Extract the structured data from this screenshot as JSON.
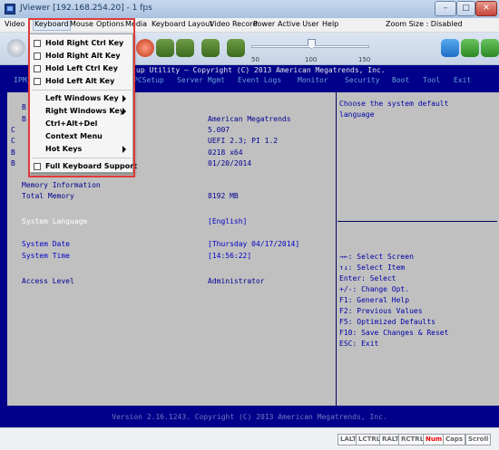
{
  "window": {
    "title": "JViewer [192.168.254.20] - 1 fps",
    "minimize": "–",
    "maximize": "□",
    "close": "✕"
  },
  "menubar": {
    "items": [
      "Video",
      "Keyboard",
      "Mouse",
      "Options",
      "Media",
      "Keyboard Layout",
      "Video Record",
      "Power",
      "Active User",
      "Help"
    ],
    "zoom": "Zoom Size : Disabled"
  },
  "toolbar": {
    "slider": {
      "min_label": "50",
      "mid_label": "100",
      "max_label": "150"
    }
  },
  "keyboard_menu": {
    "items": [
      {
        "label": "Hold Right Ctrl Key",
        "checkbox": true,
        "submenu": false
      },
      {
        "label": "Hold Right Alt Key",
        "checkbox": true,
        "submenu": false
      },
      {
        "label": "Hold Left Ctrl Key",
        "checkbox": true,
        "submenu": false
      },
      {
        "label": "Hold Left Alt Key",
        "checkbox": true,
        "submenu": false
      },
      {
        "label": "Left Windows Key",
        "checkbox": false,
        "submenu": true
      },
      {
        "label": "Right Windows Key",
        "checkbox": false,
        "submenu": true
      },
      {
        "label": "Ctrl+Alt+Del",
        "checkbox": false,
        "submenu": false
      },
      {
        "label": "Context Menu",
        "checkbox": false,
        "submenu": false
      },
      {
        "label": "Hot Keys",
        "checkbox": false,
        "submenu": true
      },
      {
        "label": "Full Keyboard Support",
        "checkbox": true,
        "submenu": false
      }
    ]
  },
  "bios": {
    "title": "Aptio Setup Utility – Copyright (C) 2013 American Megatrends, Inc.",
    "title_visible": "up Utility – Copyright (C) 2013 American Megatrends, Inc.",
    "tabs": [
      "IPMI",
      "PCSetup",
      "Server Mgmt",
      "Event Logs",
      "Monitor",
      "Security",
      "Boot",
      "Tool",
      "Exit"
    ],
    "left_labels_partial": [
      "B",
      "B",
      "C",
      "C",
      "B",
      "B"
    ],
    "values": [
      "American Megatrends",
      "5.007",
      "UEFI 2.3; PI 1.2",
      "0218 x64",
      "01/20/2014"
    ],
    "memory_header": "Memory Information",
    "total_memory_label": "Total Memory",
    "total_memory_value": "8192 MB",
    "system_language_label": "System Language",
    "system_language_value": "[English]",
    "system_date_label": "System Date",
    "system_date_value": "[Thursday 04/17/2014]",
    "system_time_label": "System Time",
    "system_time_value": "[14:56:22]",
    "access_level_label": "Access Level",
    "access_level_value": "Administrator",
    "help_top": [
      "Choose the system default",
      "language"
    ],
    "help_keys": [
      "→←: Select Screen",
      "↑↓: Select Item",
      "Enter: Select",
      "+/-: Change Opt.",
      "F1: General Help",
      "F2: Previous Values",
      "F5: Optimized Defaults",
      "F10: Save Changes & Reset",
      "ESC: Exit"
    ],
    "footer": "Version 2.16.1243. Copyright (C) 2013 American Megatrends, Inc."
  },
  "statusbar": {
    "keys": [
      "LALT",
      "LCTRL",
      "RALT",
      "RCTRL",
      "Num",
      "Caps",
      "Scroll"
    ],
    "active_key": "Num"
  }
}
